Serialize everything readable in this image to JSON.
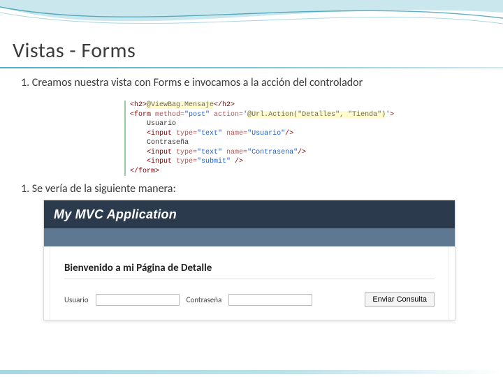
{
  "title": "Vistas - Forms",
  "step1": {
    "num": "1.",
    "text": "Creamos nuestra vista con Forms e invocamos a la acción del controlador"
  },
  "code": {
    "l1_open": "<h2>",
    "l1_razor": "@ViewBag.Mensaje",
    "l1_close": "</h2>",
    "l2_a": "<form ",
    "l2_method_attr": "method=",
    "l2_method_val": "\"post\"",
    "l2_action_attr": " action=",
    "l2_action_val_open": "'",
    "l2_action_razor": "@Url.Action(\"Detalles\", \"Tienda\")",
    "l2_action_val_close": "'",
    "l2_end": ">",
    "l3": "    Usuario",
    "l4_a": "    <input ",
    "l4_type_attr": "type=",
    "l4_type_val": "\"text\"",
    "l4_name_attr": " name=",
    "l4_name_val": "\"Usuario\"",
    "l4_end": "/>",
    "l5": "    Contraseña",
    "l6_a": "    <input ",
    "l6_type_attr": "type=",
    "l6_type_val": "\"text\"",
    "l6_name_attr": " name=",
    "l6_name_val": "\"Contrasena\"",
    "l6_end": "/>",
    "l7_a": "    <input ",
    "l7_type_attr": "type=",
    "l7_type_val": "\"submit\"",
    "l7_end": " />",
    "l8": "</form>"
  },
  "step2": {
    "num": "1.",
    "text": "Se vería de la siguiente manera:"
  },
  "preview": {
    "app_title": "My MVC Application",
    "page_heading": "Bienvenido a mi Página de Detalle",
    "label_user": "Usuario",
    "label_pass": "Contraseña",
    "submit_label": "Enviar Consulta"
  }
}
